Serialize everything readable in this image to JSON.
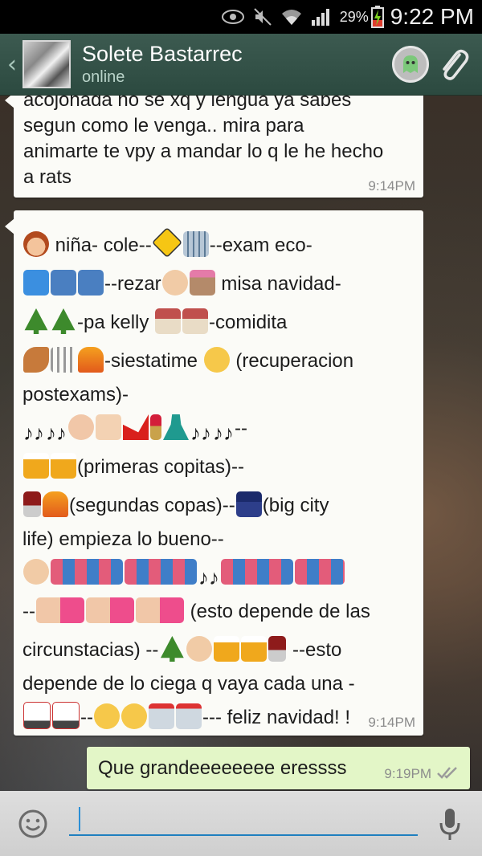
{
  "status_bar": {
    "battery_percent": "29%",
    "time": "9:22 PM",
    "icons": [
      "eye-icon",
      "mute-icon",
      "wifi-icon",
      "signal-icon",
      "battery-charging-icon"
    ]
  },
  "header": {
    "back_icon": "chevron-left-icon",
    "contact_name": "Solete Bastarrec",
    "contact_status": "online",
    "attach_icon": "paperclip-icon",
    "ghost_icon": "ghost-icon"
  },
  "messages": [
    {
      "direction": "incoming",
      "lines": [
        "acojonada no se xq y lengua ya sabes",
        "segun como le venga.. mira para",
        "animarte te vpy a mandar lo q le he hecho",
        "a rats"
      ],
      "time": "9:14PM"
    },
    {
      "direction": "incoming",
      "segments": {
        "l1a": "niña- cole--",
        "l1b": "--exam eco-",
        "l2a": "--rezar",
        "l2b": " misa navidad-",
        "l3a": "-pa kelly ",
        "l3b": "-comidita",
        "l4a": "-siestatime ",
        "l4b": " (recuperacion",
        "l5": "postexams)-",
        "l6a": "--",
        "l7a": "(primeras copitas)--",
        "l8a": "(segundas copas)--",
        "l8b": "(big city",
        "l9": "life) empieza lo bueno--",
        "l11a": "--",
        "l11b": " (esto depende de las",
        "l12a": "circunstacias) --",
        "l12b": " --esto",
        "l13": "depende de lo ciega q vaya cada una -",
        "l14a": "--",
        "l14b": "--- feliz navidad! !"
      },
      "time": "9:14PM"
    },
    {
      "direction": "outgoing",
      "text": "Que grandeeeeeeee eressss",
      "time": "9:19PM",
      "status_icon": "double-check-icon"
    }
  ],
  "input_bar": {
    "emoji_icon": "smiley-icon",
    "placeholder": "",
    "mic_icon": "microphone-icon"
  },
  "colors": {
    "action_bar": "#3c5a50",
    "bubble_in": "#fbfbf7",
    "bubble_out": "#e3f6c7",
    "accent": "#1f7fbf"
  }
}
